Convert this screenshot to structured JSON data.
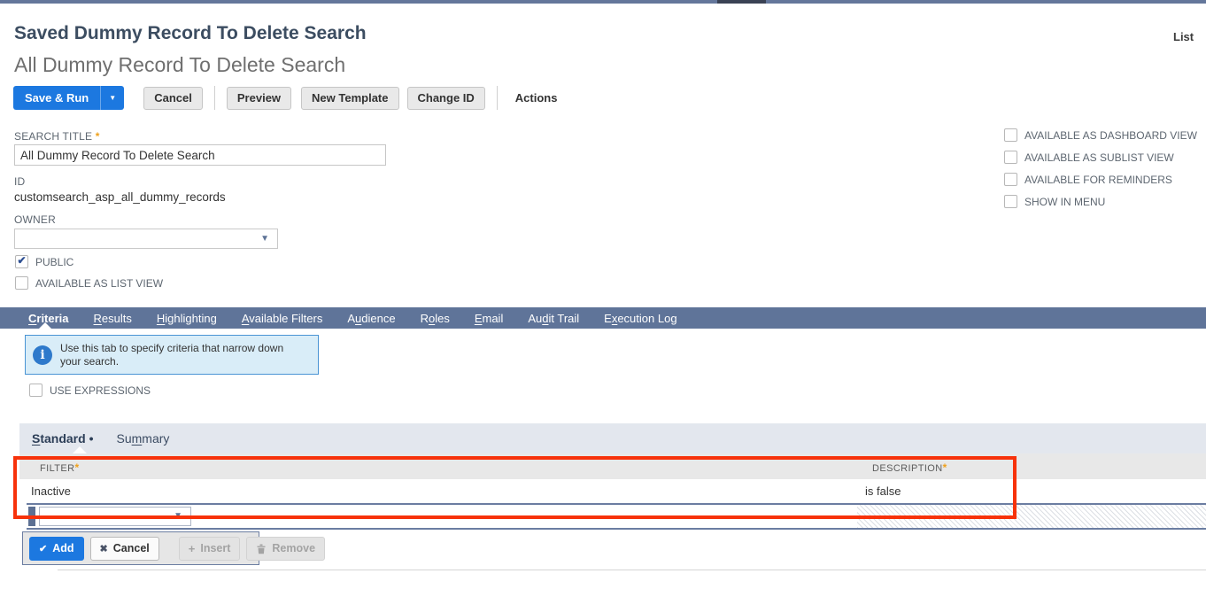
{
  "colors": {
    "primary_blue": "#1c78e0",
    "tab_bar": "#5f7499",
    "top_bar": "#64779b",
    "top_bar_dark_segment": "#3a4254",
    "highlight_red": "#f7320b",
    "info_bg": "#d9edf8",
    "info_border": "#4a94d4",
    "required_asterisk": "#efa11c",
    "checkmark_blue": "#2d4f92"
  },
  "ui": {
    "required_mark": "*",
    "check_glyph": "✔",
    "x_glyph": "✖",
    "plus_glyph": "+",
    "dropdown_glyph": "▼",
    "info_glyph": "i",
    "bullet": "•"
  },
  "header": {
    "page_title": "Saved Dummy Record To Delete Search",
    "record_title": "All Dummy Record To Delete Search",
    "list_link": "List"
  },
  "toolbar": {
    "save_run": "Save & Run",
    "cancel": "Cancel",
    "preview": "Preview",
    "new_template": "New Template",
    "change_id": "Change ID",
    "actions": "Actions"
  },
  "form": {
    "search_title_label": "SEARCH TITLE",
    "search_title_value": "All Dummy Record To Delete Search",
    "id_label": "ID",
    "id_value": "customsearch_asp_all_dummy_records",
    "owner_label": "OWNER",
    "owner_value": "",
    "public_label": "PUBLIC",
    "public_checked": true,
    "available_as_list_view_label": "AVAILABLE AS LIST VIEW",
    "available_as_list_view_checked": false,
    "right_options": [
      {
        "label": "AVAILABLE AS DASHBOARD VIEW",
        "checked": false
      },
      {
        "label": "AVAILABLE AS SUBLIST VIEW",
        "checked": false
      },
      {
        "label": "AVAILABLE FOR REMINDERS",
        "checked": false
      },
      {
        "label": "SHOW IN MENU",
        "checked": false
      }
    ]
  },
  "tabs": [
    {
      "pre": "",
      "key": "C",
      "post": "riteria",
      "active": true
    },
    {
      "pre": "",
      "key": "R",
      "post": "esults",
      "active": false
    },
    {
      "pre": "",
      "key": "H",
      "post": "ighlighting",
      "active": false
    },
    {
      "pre": "",
      "key": "A",
      "post": "vailable Filters",
      "active": false
    },
    {
      "pre": "A",
      "key": "u",
      "post": "dience",
      "active": false
    },
    {
      "pre": "R",
      "key": "o",
      "post": "les",
      "active": false
    },
    {
      "pre": "",
      "key": "E",
      "post": "mail",
      "active": false
    },
    {
      "pre": "Au",
      "key": "d",
      "post": "it Trail",
      "active": false
    },
    {
      "pre": "E",
      "key": "x",
      "post": "ecution Log",
      "active": false
    }
  ],
  "info_box": {
    "text": "Use this tab to specify criteria that narrow down your search."
  },
  "criteria": {
    "use_expressions_label": "USE EXPRESSIONS",
    "subtabs": {
      "standard": {
        "pre": "",
        "key": "S",
        "post": "tandard",
        "active": true
      },
      "summary": {
        "pre": "Su",
        "key": "m",
        "post": "mary",
        "active": false
      }
    },
    "table": {
      "filter_header": "FILTER",
      "description_header": "DESCRIPTION",
      "rows": [
        {
          "filter": "Inactive",
          "description": "is false"
        }
      ]
    },
    "buttons": {
      "add": "Add",
      "cancel": "Cancel",
      "insert": "Insert",
      "remove": "Remove"
    }
  }
}
